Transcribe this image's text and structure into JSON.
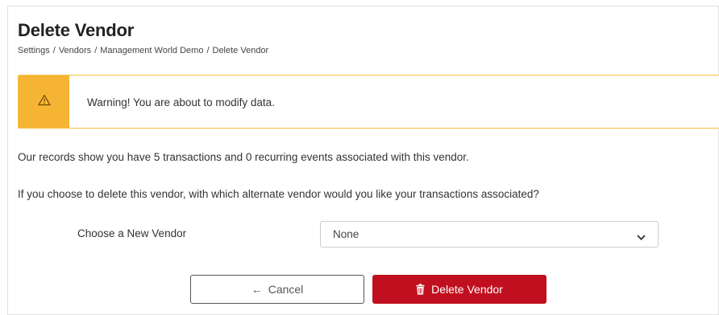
{
  "header": {
    "title": "Delete Vendor",
    "breadcrumb": [
      "Settings",
      "Vendors",
      "Management World Demo",
      "Delete Vendor"
    ],
    "breadcrumb_separator": "/"
  },
  "warning": {
    "icon": "warning-triangle-icon",
    "text": "Warning! You are about to modify data.",
    "accent_color": "#f5b433"
  },
  "body": {
    "records_text": "Our records show you have 5 transactions and 0 recurring events associated with this vendor.",
    "question_text": "If you choose to delete this vendor, with which alternate vendor would you like your transactions associated?"
  },
  "form": {
    "new_vendor_label": "Choose a New Vendor",
    "new_vendor_value": "None"
  },
  "actions": {
    "cancel_label": "Cancel",
    "cancel_icon": "arrow-left-icon",
    "delete_label": "Delete Vendor",
    "delete_icon": "trash-icon",
    "delete_color": "#c0101f"
  }
}
